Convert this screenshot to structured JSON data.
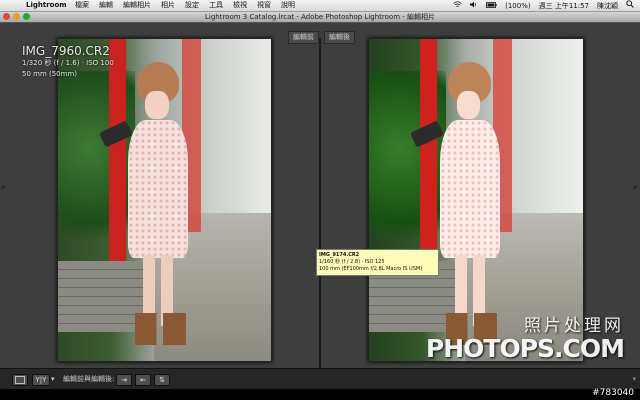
{
  "menubar": {
    "apple_glyph": "",
    "app_name": "Lightroom",
    "menus": [
      "檔案",
      "編輯",
      "編輯相片",
      "相片",
      "設定",
      "工具",
      "檢視",
      "視窗",
      "說明"
    ],
    "battery": "(100%)",
    "clock": "週三 上午11:57",
    "user": "陳沈穎"
  },
  "window": {
    "title": "Lightroom 3 Catalog.lrcat - Adobe Photoshop Lightroom - 編輯相片"
  },
  "compare": {
    "before_label": "編輯前",
    "after_label": "編輯後"
  },
  "photo_meta": {
    "filename": "IMG_7960.CR2",
    "exposure": "1/320 秒 (f / 1.6) · ISO 100",
    "lens": "50 mm (50mm)"
  },
  "tooltip": {
    "filename": "IMG_9174.CR2",
    "exposure": "1/160 秒 (f / 2.8) · ISO 125",
    "lens": "100 mm (EF100mm f/2.8L Macro IS USM)"
  },
  "watermark": {
    "chinese": "照片处理网",
    "english": "PHOTOPS.COM"
  },
  "toolbar": {
    "view_mode": "Y|Y",
    "dropdown_arrow": "▾",
    "copy_label": "編輯前與編輯後:",
    "copy_before_icon": "⇥",
    "copy_after_icon": "⇤",
    "swap_icon": "⇅"
  },
  "footer": {
    "image_id": "#783040"
  },
  "colors": {
    "workspace": "#3e3e3e",
    "tooltip_bg": "#fdfcb8",
    "red_post": "#c8231f"
  }
}
